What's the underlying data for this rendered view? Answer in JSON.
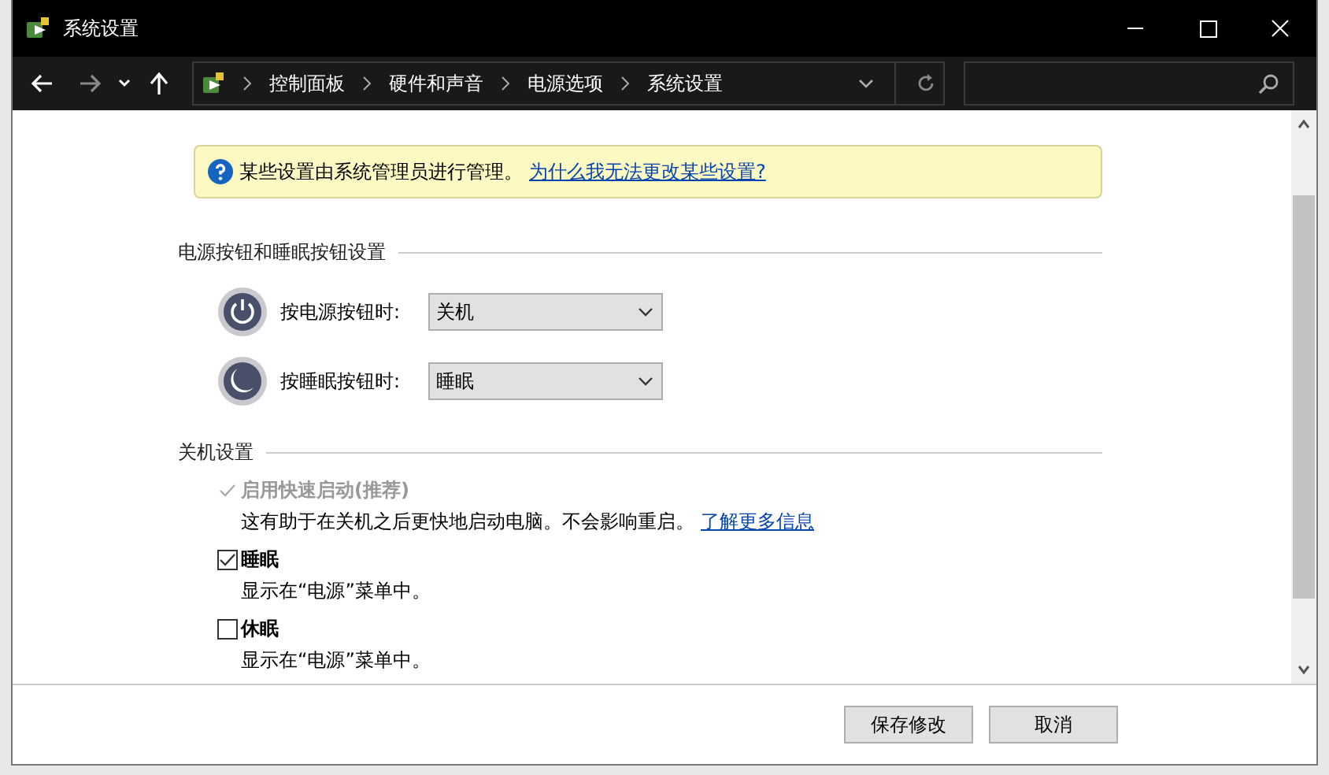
{
  "window": {
    "title": "系统设置"
  },
  "breadcrumb": [
    "控制面板",
    "硬件和声音",
    "电源选项",
    "系统设置"
  ],
  "notice": {
    "text": "某些设置由系统管理员进行管理。",
    "link": "为什么我无法更改某些设置?"
  },
  "power_section": {
    "title": "电源按钮和睡眠按钮设置",
    "rows": [
      {
        "kind": "power",
        "label": "按电源按钮时:",
        "value": "关机"
      },
      {
        "kind": "sleep",
        "label": "按睡眠按钮时:",
        "value": "睡眠"
      }
    ]
  },
  "shutdown_section": {
    "title": "关机设置",
    "options": [
      {
        "label": "启用快速启动(推荐)",
        "checked": true,
        "disabled": true,
        "description": "这有助于在关机之后更快地启动电脑。不会影响重启。",
        "link": "了解更多信息"
      },
      {
        "label": "睡眠",
        "checked": true,
        "disabled": false,
        "description": "显示在“电源”菜单中。"
      },
      {
        "label": "休眠",
        "checked": false,
        "disabled": false,
        "description": "显示在“电源”菜单中。"
      }
    ]
  },
  "buttons": [
    {
      "label": "保存修改",
      "disabled": false
    },
    {
      "label": "取消",
      "disabled": false
    }
  ]
}
